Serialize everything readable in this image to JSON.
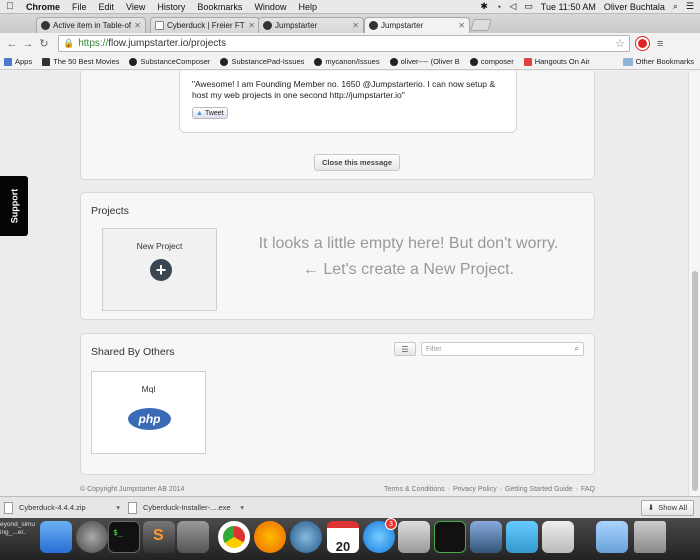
{
  "menubar": {
    "items": [
      "Chrome",
      "File",
      "Edit",
      "View",
      "History",
      "Bookmarks",
      "Window",
      "Help"
    ],
    "clock": "Tue 11:50 AM",
    "user": "Oliver Buchtala"
  },
  "tabs": [
    {
      "title": "Active item in Table-of-c"
    },
    {
      "title": "Cyberduck | Freier FTP, SF"
    },
    {
      "title": "Jumpstarter"
    },
    {
      "title": "Jumpstarter"
    }
  ],
  "omnibox": {
    "scheme": "https://",
    "host": "flow.jumpstarter.io",
    "path": "/projects"
  },
  "bookmarks": [
    "Apps",
    "The 50 Best Movies",
    "SubstanceComposer",
    "SubstancePad-Issues",
    "mycanon/Issues",
    "oliver---- (Oliver B",
    "composer",
    "Hangouts On Air"
  ],
  "other_bookmarks": "Other Bookmarks",
  "support_label": "Support",
  "message": {
    "tweet_text": "\"Awesome! I am Founding Member no. 1650 @Jumpstarterio. I can now setup & host my web projects in one second http://jumpstarter.io\"",
    "tweet_button": "Tweet",
    "close_label": "Close this message"
  },
  "projects": {
    "title": "Projects",
    "new_project_label": "New Project",
    "empty_line1": "It looks a little empty here! But don't worry.",
    "empty_line2": "← Let's create a New Project."
  },
  "shared": {
    "title": "Shared By Others",
    "filter_placeholder": "Filter",
    "card_label": "Mql",
    "logo_text": "php"
  },
  "footer": {
    "copyright": "© Copyright Jumpstarter AB 2014",
    "links": [
      "Terms & Conditions",
      "Privacy Policy",
      "Getting Started Guide",
      "FAQ"
    ]
  },
  "downloads": [
    {
      "name": "Cyberduck-4.4.4.zip"
    },
    {
      "name": "Cyberduck-Installer-....exe"
    }
  ],
  "show_all": "Show All",
  "dock": {
    "side_text": [
      "eyond_simu",
      "ing_...er.."
    ],
    "calendar_day": "20",
    "appstore_badge": "3",
    "terminal_text": "$_"
  },
  "colors": {
    "page_bg": "#ececec",
    "panel_bg": "#f7f7f7",
    "php_blue": "#3b6ab6",
    "url_green": "#2e8a2e"
  }
}
